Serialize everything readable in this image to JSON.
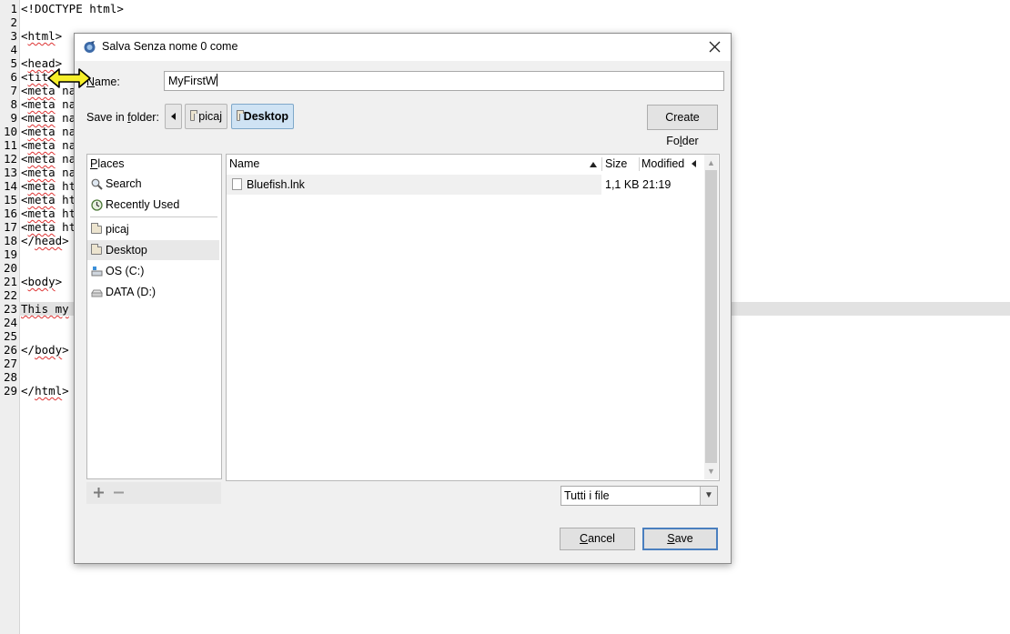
{
  "editor": {
    "lines": [
      {
        "n": "1",
        "text": "<!DOCTYPE html>"
      },
      {
        "n": "2",
        "text": ""
      },
      {
        "n": "3",
        "text": "<html>"
      },
      {
        "n": "4",
        "text": ""
      },
      {
        "n": "5",
        "text": "<head>"
      },
      {
        "n": "6",
        "text": "<tit"
      },
      {
        "n": "7",
        "text": "<meta na"
      },
      {
        "n": "8",
        "text": "<meta na"
      },
      {
        "n": "9",
        "text": "<meta na"
      },
      {
        "n": "10",
        "text": "<meta na"
      },
      {
        "n": "11",
        "text": "<meta na"
      },
      {
        "n": "12",
        "text": "<meta na"
      },
      {
        "n": "13",
        "text": "<meta na"
      },
      {
        "n": "14",
        "text": "<meta ht"
      },
      {
        "n": "15",
        "text": "<meta ht"
      },
      {
        "n": "16",
        "text": "<meta ht"
      },
      {
        "n": "17",
        "text": "<meta ht"
      },
      {
        "n": "18",
        "text": "</head>"
      },
      {
        "n": "19",
        "text": ""
      },
      {
        "n": "20",
        "text": ""
      },
      {
        "n": "21",
        "text": "<body>"
      },
      {
        "n": "22",
        "text": ""
      },
      {
        "n": "23",
        "text": "This my"
      },
      {
        "n": "24",
        "text": ""
      },
      {
        "n": "25",
        "text": ""
      },
      {
        "n": "26",
        "text": "</body>"
      },
      {
        "n": "27",
        "text": ""
      },
      {
        "n": "28",
        "text": ""
      },
      {
        "n": "29",
        "text": "</html>"
      }
    ]
  },
  "dialog": {
    "title": "Salva Senza nome 0 come",
    "close_icon": "close-icon",
    "name_label": "Name:",
    "name_value": "MyFirstW",
    "save_in_label": "Save in folder:",
    "path": [
      "picaj",
      "Desktop"
    ],
    "create_folder_label": "Create Folder",
    "places": {
      "header": "Places",
      "items": [
        {
          "label": "Search",
          "icon": "search-icon"
        },
        {
          "label": "Recently Used",
          "icon": "recent-icon"
        },
        {
          "label": "picaj",
          "icon": "folder-icon"
        },
        {
          "label": "Desktop",
          "icon": "folder-icon",
          "selected": true
        },
        {
          "label": "OS (C:)",
          "icon": "drive-icon"
        },
        {
          "label": "DATA (D:)",
          "icon": "drive-icon"
        }
      ],
      "add_icon": "add-icon",
      "remove_icon": "remove-icon"
    },
    "columns": {
      "name": "Name",
      "size": "Size",
      "modified": "Modified"
    },
    "files": [
      {
        "name": "Bluefish.lnk",
        "size": "1,1 KB",
        "modified": "21:19"
      }
    ],
    "filter": "Tutti i file",
    "cancel_label": "Cancel",
    "save_label": "Save"
  }
}
